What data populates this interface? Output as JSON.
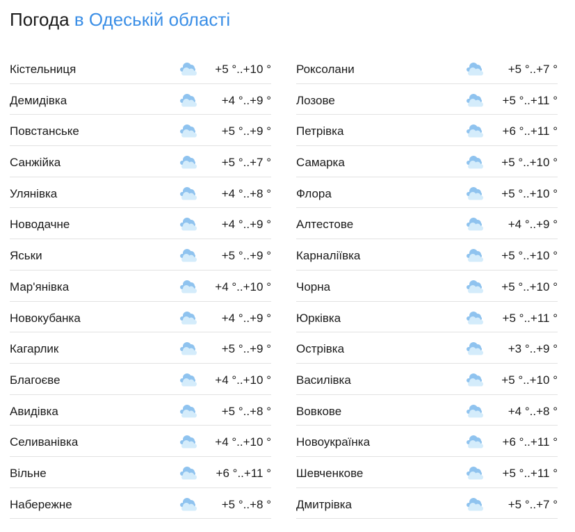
{
  "header": {
    "title_main": "Погода",
    "title_region": "в Одеській області"
  },
  "icon": "cloud-icon",
  "colors": {
    "accent": "#3a8ee6",
    "cloud_dark": "#8fc3ef",
    "cloud_light": "#d4ecfb"
  },
  "columns": [
    [
      {
        "name": "Кістельниця",
        "temp": "+5 °..+10 °"
      },
      {
        "name": "Демидівка",
        "temp": "+4 °..+9 °"
      },
      {
        "name": "Повстанське",
        "temp": "+5 °..+9 °"
      },
      {
        "name": "Санжійка",
        "temp": "+5 °..+7 °"
      },
      {
        "name": "Улянівка",
        "temp": "+4 °..+8 °"
      },
      {
        "name": "Новодачне",
        "temp": "+4 °..+9 °"
      },
      {
        "name": "Яськи",
        "temp": "+5 °..+9 °"
      },
      {
        "name": "Мар'янівка",
        "temp": "+4 °..+10 °"
      },
      {
        "name": "Новокубанка",
        "temp": "+4 °..+9 °"
      },
      {
        "name": "Кагарлик",
        "temp": "+5 °..+9 °"
      },
      {
        "name": "Благоєве",
        "temp": "+4 °..+10 °"
      },
      {
        "name": "Авидівка",
        "temp": "+5 °..+8 °"
      },
      {
        "name": "Селиванівка",
        "temp": "+4 °..+10 °"
      },
      {
        "name": "Вільне",
        "temp": "+6 °..+11 °"
      },
      {
        "name": "Набережне",
        "temp": "+5 °..+8 °"
      }
    ],
    [
      {
        "name": "Роксолани",
        "temp": "+5 °..+7 °"
      },
      {
        "name": "Лозове",
        "temp": "+5 °..+11 °"
      },
      {
        "name": "Петрівка",
        "temp": "+6 °..+11 °"
      },
      {
        "name": "Самарка",
        "temp": "+5 °..+10 °"
      },
      {
        "name": "Флора",
        "temp": "+5 °..+10 °"
      },
      {
        "name": "Алтестове",
        "temp": "+4 °..+9 °"
      },
      {
        "name": "Карналіївка",
        "temp": "+5 °..+10 °"
      },
      {
        "name": "Чорна",
        "temp": "+5 °..+10 °"
      },
      {
        "name": "Юрківка",
        "temp": "+5 °..+11 °"
      },
      {
        "name": "Острівка",
        "temp": "+3 °..+9 °"
      },
      {
        "name": "Василівка",
        "temp": "+5 °..+10 °"
      },
      {
        "name": "Вовкове",
        "temp": "+4 °..+8 °"
      },
      {
        "name": "Новоукраїнка",
        "temp": "+6 °..+11 °"
      },
      {
        "name": "Шевченкове",
        "temp": "+5 °..+11 °"
      },
      {
        "name": "Дмитрівка",
        "temp": "+5 °..+7 °"
      }
    ]
  ]
}
